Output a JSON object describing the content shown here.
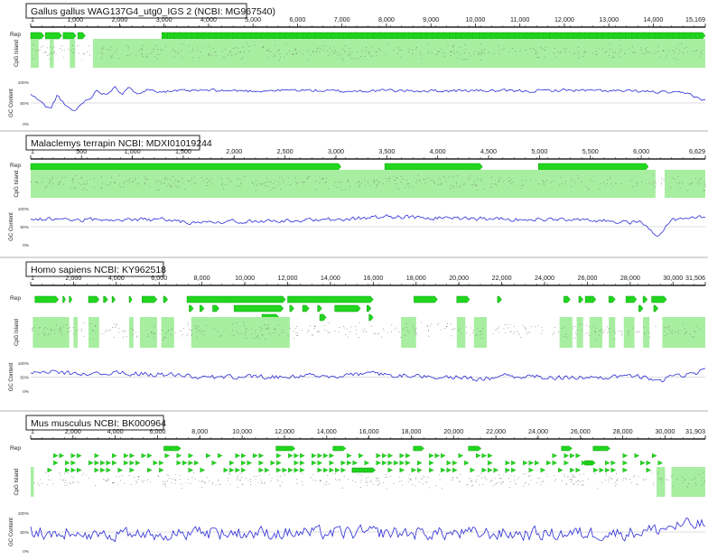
{
  "figure": {
    "colors": {
      "feature": "#22d61f",
      "feature_edge": "#0d9e0b",
      "cpg": "#a8eea1",
      "gc_line": "#2b2bd6",
      "axis": "#222222",
      "ref_line": "#bbbbbb"
    },
    "labels": {
      "rep": "Rep",
      "cpg": "CpG Island",
      "gc": "GC Content",
      "gc_ticks": [
        "100%",
        "50%",
        "0%"
      ]
    }
  },
  "chart_data": [
    {
      "type": "line",
      "title": "Gallus gallus WAG137G4_utg0_IGS 2 (NCBI: MG967540)",
      "length": 15169,
      "x_ticks": [
        1,
        1000,
        2000,
        3000,
        4000,
        5000,
        6000,
        7000,
        8000,
        9000,
        10000,
        11000,
        12000,
        13000,
        14000,
        15169
      ],
      "x_tick_labels": [
        "1",
        "1,000",
        "2,000",
        "3,000",
        "4,000",
        "5,000",
        "6,000",
        "7,000",
        "8,000",
        "9,000",
        "10,000",
        "11,000",
        "12,000",
        "13,000",
        "14,000",
        "15,169"
      ],
      "ylabel": "GC Content",
      "ylim": [
        0,
        100
      ],
      "rep_features": [
        [
          1,
          300,
          0
        ],
        [
          330,
          700,
          0
        ],
        [
          730,
          1020,
          0
        ],
        [
          1060,
          1230,
          0
        ],
        [
          2950,
          15169,
          0
        ]
      ],
      "rep_arrow_repeat": [
        [
          2950,
          15169
        ]
      ],
      "cpg_islands": [
        [
          1,
          180
        ],
        [
          430,
          520
        ],
        [
          880,
          1000
        ],
        [
          1400,
          15169
        ]
      ],
      "gc_profile": [
        [
          0,
          70
        ],
        [
          150,
          60
        ],
        [
          300,
          45
        ],
        [
          450,
          35
        ],
        [
          600,
          70
        ],
        [
          800,
          40
        ],
        [
          1000,
          30
        ],
        [
          1150,
          50
        ],
        [
          1300,
          60
        ],
        [
          1500,
          80
        ],
        [
          1700,
          70
        ],
        [
          1900,
          92
        ],
        [
          2050,
          70
        ],
        [
          2200,
          85
        ],
        [
          2400,
          75
        ],
        [
          2600,
          82
        ],
        [
          3000,
          78
        ],
        [
          4000,
          80
        ],
        [
          5000,
          79
        ],
        [
          6000,
          81
        ],
        [
          7000,
          78
        ],
        [
          8000,
          80
        ],
        [
          9000,
          79
        ],
        [
          10000,
          80
        ],
        [
          11000,
          78
        ],
        [
          12000,
          81
        ],
        [
          13000,
          79
        ],
        [
          14000,
          77
        ],
        [
          14800,
          72
        ],
        [
          15169,
          55
        ]
      ],
      "gc_amp": 5
    },
    {
      "type": "line",
      "title": "Malaclemys terrapin NCBI: MDXI01019244",
      "length": 6629,
      "x_ticks": [
        1,
        500,
        1000,
        1500,
        2000,
        2500,
        3000,
        3500,
        4000,
        4500,
        5000,
        5500,
        6000,
        6629
      ],
      "x_tick_labels": [
        "1",
        "500",
        "1,000",
        "1,500",
        "2,000",
        "2,500",
        "3,000",
        "3,500",
        "4,000",
        "4,500",
        "5,000",
        "5,500",
        "6,000",
        "6,629"
      ],
      "ylabel": "GC Content",
      "ylim": [
        0,
        100
      ],
      "rep_features": [
        [
          1,
          3050,
          0
        ],
        [
          3480,
          4440,
          0
        ],
        [
          4990,
          6070,
          0
        ]
      ],
      "rep_arrow_repeat": [],
      "cpg_islands": [
        [
          1,
          6140
        ],
        [
          6230,
          6629
        ]
      ],
      "gc_profile": [
        [
          0,
          72
        ],
        [
          700,
          68
        ],
        [
          1300,
          70
        ],
        [
          1600,
          60
        ],
        [
          2300,
          66
        ],
        [
          3000,
          70
        ],
        [
          3500,
          78
        ],
        [
          4000,
          74
        ],
        [
          4500,
          72
        ],
        [
          5000,
          70
        ],
        [
          5600,
          66
        ],
        [
          6000,
          60
        ],
        [
          6150,
          20
        ],
        [
          6300,
          70
        ],
        [
          6629,
          78
        ]
      ],
      "gc_amp": 8
    },
    {
      "type": "line",
      "title": "Homo sapiens NCBI: KY962518",
      "length": 31506,
      "x_ticks": [
        1,
        2000,
        4000,
        6000,
        8000,
        10000,
        12000,
        14000,
        16000,
        18000,
        20000,
        22000,
        24000,
        26000,
        28000,
        30000,
        31506
      ],
      "x_tick_labels": [
        "1",
        "2,000",
        "4,000",
        "6,000",
        "8,000",
        "10,000",
        "12,000",
        "14,000",
        "16,000",
        "18,000",
        "20,000",
        "22,000",
        "24,000",
        "26,000",
        "28,000",
        "30,000",
        "31,506"
      ],
      "ylabel": "GC Content",
      "ylim": [
        0,
        100
      ],
      "rep_features": [
        [
          200,
          1300,
          0
        ],
        [
          1500,
          1600,
          0
        ],
        [
          1800,
          1900,
          0
        ],
        [
          2700,
          3200,
          0
        ],
        [
          3400,
          3600,
          0
        ],
        [
          3800,
          3950,
          0
        ],
        [
          4600,
          4700,
          0
        ],
        [
          5200,
          5900,
          0
        ],
        [
          6200,
          6400,
          0
        ],
        [
          7300,
          11900,
          0
        ],
        [
          12000,
          16000,
          0
        ],
        [
          7400,
          7600,
          1
        ],
        [
          7900,
          8100,
          1
        ],
        [
          8500,
          8800,
          1
        ],
        [
          9500,
          11800,
          1
        ],
        [
          12100,
          12300,
          1
        ],
        [
          12700,
          13000,
          1
        ],
        [
          13400,
          13600,
          1
        ],
        [
          14200,
          15400,
          1
        ],
        [
          15700,
          15900,
          1
        ],
        [
          10800,
          11600,
          2
        ],
        [
          13500,
          13800,
          2
        ],
        [
          15800,
          16000,
          2
        ],
        [
          17900,
          19000,
          0
        ],
        [
          19900,
          20500,
          0
        ],
        [
          21800,
          22000,
          0
        ],
        [
          24900,
          25200,
          0
        ],
        [
          25600,
          25800,
          0
        ],
        [
          25900,
          26400,
          0
        ],
        [
          27000,
          27300,
          0
        ],
        [
          27800,
          28300,
          0
        ],
        [
          28600,
          28800,
          0
        ],
        [
          29000,
          29700,
          0
        ],
        [
          28400,
          28600,
          1
        ],
        [
          29100,
          29300,
          1
        ]
      ],
      "rep_arrow_repeat": [],
      "cpg_islands": [
        [
          100,
          1800
        ],
        [
          2000,
          2200
        ],
        [
          2700,
          3200
        ],
        [
          4600,
          4800
        ],
        [
          5100,
          5900
        ],
        [
          6100,
          6700
        ],
        [
          7500,
          12100
        ],
        [
          17300,
          18000
        ],
        [
          19900,
          20300
        ],
        [
          20700,
          21300
        ],
        [
          24700,
          25300
        ],
        [
          25500,
          25800
        ],
        [
          26100,
          26700
        ],
        [
          27000,
          27300
        ],
        [
          27700,
          28200
        ],
        [
          28600,
          28900
        ],
        [
          29500,
          31506
        ]
      ],
      "gc_profile": [
        [
          0,
          70
        ],
        [
          2000,
          62
        ],
        [
          4000,
          65
        ],
        [
          6000,
          60
        ],
        [
          7000,
          58
        ],
        [
          8000,
          48
        ],
        [
          10000,
          50
        ],
        [
          12000,
          52
        ],
        [
          14000,
          55
        ],
        [
          16000,
          60
        ],
        [
          18000,
          55
        ],
        [
          20000,
          50
        ],
        [
          21000,
          40
        ],
        [
          22000,
          55
        ],
        [
          24000,
          50
        ],
        [
          26000,
          48
        ],
        [
          28000,
          55
        ],
        [
          29500,
          40
        ],
        [
          30500,
          60
        ],
        [
          31506,
          72
        ]
      ],
      "gc_amp": 12
    },
    {
      "type": "line",
      "title": "Mus musculus NCBI: BK000964",
      "length": 31903,
      "x_ticks": [
        1,
        2000,
        4000,
        6000,
        8000,
        10000,
        12000,
        14000,
        16000,
        18000,
        20000,
        22000,
        24000,
        26000,
        28000,
        30000,
        31903
      ],
      "x_tick_labels": [
        "1",
        "2,000",
        "4,000",
        "6,000",
        "8,000",
        "10,000",
        "12,000",
        "14,000",
        "16,000",
        "18,000",
        "20,000",
        "22,000",
        "24,000",
        "26,000",
        "28,000",
        "30,000",
        "31,903"
      ],
      "ylabel": "GC Content",
      "ylim": [
        0,
        100
      ],
      "rep_features": [
        [
          6300,
          7100,
          0
        ],
        [
          11600,
          12500,
          0
        ],
        [
          14300,
          14900,
          0
        ],
        [
          18100,
          18600,
          0
        ],
        [
          20700,
          21300,
          0
        ],
        [
          25100,
          25600,
          0
        ],
        [
          26600,
          27400,
          0
        ],
        [
          15200,
          16300,
          3
        ],
        [
          26200,
          26700,
          2
        ]
      ],
      "rep_arrow_repeat": [
        [
          800,
          30000,
          1
        ],
        [
          800,
          30000,
          2
        ],
        [
          800,
          30000,
          3
        ]
      ],
      "cpg_islands": [
        [
          1,
          150
        ],
        [
          29600,
          30000
        ],
        [
          30300,
          31903
        ]
      ],
      "gc_profile": [
        [
          0,
          50
        ],
        [
          4000,
          45
        ],
        [
          8000,
          48
        ],
        [
          12000,
          47
        ],
        [
          16000,
          48
        ],
        [
          20000,
          46
        ],
        [
          24000,
          45
        ],
        [
          28000,
          47
        ],
        [
          29500,
          55
        ],
        [
          30500,
          66
        ],
        [
          31903,
          70
        ]
      ],
      "gc_amp": 25
    }
  ]
}
